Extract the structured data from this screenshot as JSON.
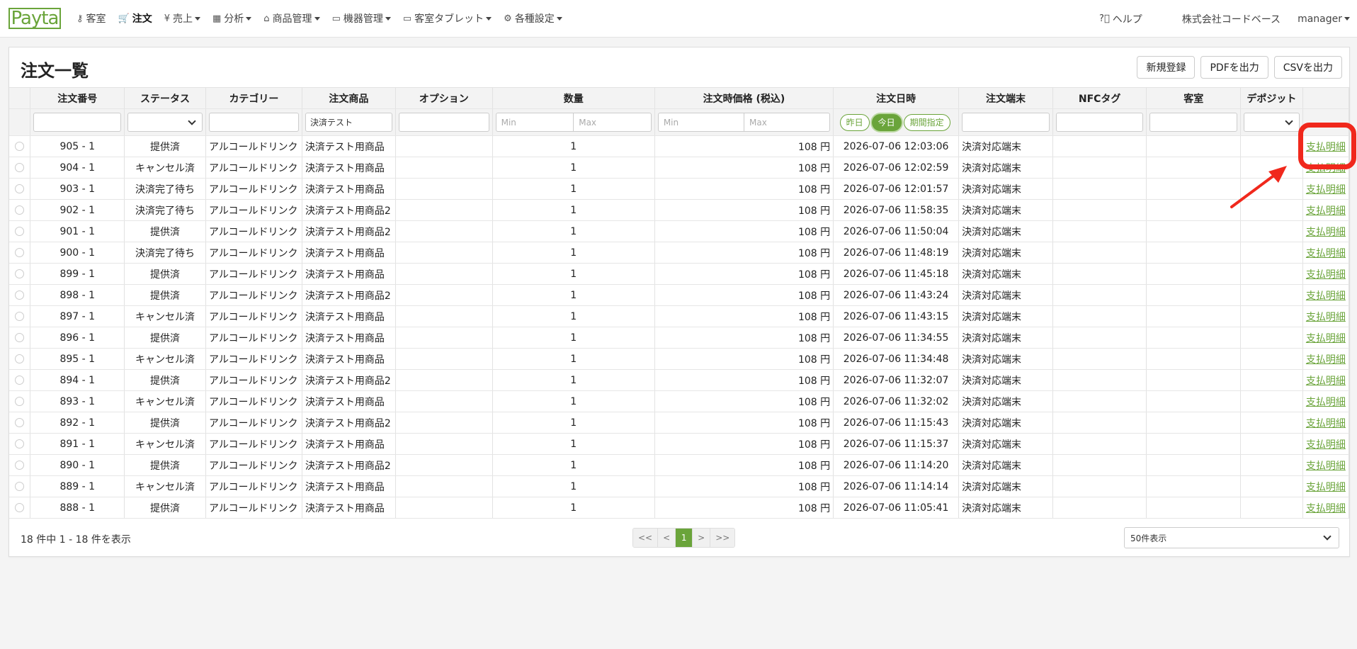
{
  "nav": {
    "logo": "Payta",
    "items": [
      {
        "label": "客室",
        "icon": "key-icon",
        "glyph": "⚷",
        "caret": false,
        "active": false
      },
      {
        "label": "注文",
        "icon": "cart-icon",
        "glyph": "🛒",
        "caret": false,
        "active": true
      },
      {
        "label": "売上",
        "icon": "yen-icon",
        "glyph": "¥",
        "caret": true,
        "active": false
      },
      {
        "label": "分析",
        "icon": "table-icon",
        "glyph": "▦",
        "caret": true,
        "active": false
      },
      {
        "label": "商品管理",
        "icon": "shop-icon",
        "glyph": "⌂",
        "caret": true,
        "active": false
      },
      {
        "label": "機器管理",
        "icon": "device-icon",
        "glyph": "▭",
        "caret": true,
        "active": false
      },
      {
        "label": "客室タブレット",
        "icon": "tablet-icon",
        "glyph": "▭",
        "caret": true,
        "active": false
      },
      {
        "label": "各種設定",
        "icon": "gear-icon",
        "glyph": "⚙",
        "caret": true,
        "active": false
      }
    ],
    "help": "ヘルプ",
    "company": "株式会社コードベース",
    "user": "manager"
  },
  "page": {
    "title": "注文一覧",
    "buttons": [
      "新規登録",
      "PDFを出力",
      "CSVを出力"
    ]
  },
  "table": {
    "headers": [
      "",
      "注文番号",
      "ステータス",
      "カテゴリー",
      "注文商品",
      "オプション",
      "数量",
      "注文時価格 (税込)",
      "注文日時",
      "注文端末",
      "NFCタグ",
      "客室",
      "デポジット",
      ""
    ],
    "filters": {
      "product_value": "決済テスト",
      "min": "Min",
      "max": "Max",
      "pill_yesterday": "昨日",
      "pill_today": "今日",
      "pill_range": "期間指定"
    },
    "rows": [
      {
        "no": "905 - 1",
        "status": "提供済",
        "cat": "アルコールドリンク",
        "item": "決済テスト用商品",
        "qty": "1",
        "price": "108 円",
        "time": "2026-07-06 12:03:06",
        "term": "決済対応端末",
        "link": "支払明細"
      },
      {
        "no": "904 - 1",
        "status": "キャンセル済",
        "cat": "アルコールドリンク",
        "item": "決済テスト用商品",
        "qty": "1",
        "price": "108 円",
        "time": "2026-07-06 12:02:59",
        "term": "決済対応端末",
        "link": "支払明細"
      },
      {
        "no": "903 - 1",
        "status": "決済完了待ち",
        "cat": "アルコールドリンク",
        "item": "決済テスト用商品",
        "qty": "1",
        "price": "108 円",
        "time": "2026-07-06 12:01:57",
        "term": "決済対応端末",
        "link": "支払明細"
      },
      {
        "no": "902 - 1",
        "status": "決済完了待ち",
        "cat": "アルコールドリンク",
        "item": "決済テスト用商品2",
        "qty": "1",
        "price": "108 円",
        "time": "2026-07-06 11:58:35",
        "term": "決済対応端末",
        "link": "支払明細"
      },
      {
        "no": "901 - 1",
        "status": "提供済",
        "cat": "アルコールドリンク",
        "item": "決済テスト用商品2",
        "qty": "1",
        "price": "108 円",
        "time": "2026-07-06 11:50:04",
        "term": "決済対応端末",
        "link": "支払明細"
      },
      {
        "no": "900 - 1",
        "status": "決済完了待ち",
        "cat": "アルコールドリンク",
        "item": "決済テスト用商品",
        "qty": "1",
        "price": "108 円",
        "time": "2026-07-06 11:48:19",
        "term": "決済対応端末",
        "link": "支払明細"
      },
      {
        "no": "899 - 1",
        "status": "提供済",
        "cat": "アルコールドリンク",
        "item": "決済テスト用商品",
        "qty": "1",
        "price": "108 円",
        "time": "2026-07-06 11:45:18",
        "term": "決済対応端末",
        "link": "支払明細"
      },
      {
        "no": "898 - 1",
        "status": "提供済",
        "cat": "アルコールドリンク",
        "item": "決済テスト用商品2",
        "qty": "1",
        "price": "108 円",
        "time": "2026-07-06 11:43:24",
        "term": "決済対応端末",
        "link": "支払明細"
      },
      {
        "no": "897 - 1",
        "status": "キャンセル済",
        "cat": "アルコールドリンク",
        "item": "決済テスト用商品",
        "qty": "1",
        "price": "108 円",
        "time": "2026-07-06 11:43:15",
        "term": "決済対応端末",
        "link": "支払明細"
      },
      {
        "no": "896 - 1",
        "status": "提供済",
        "cat": "アルコールドリンク",
        "item": "決済テスト用商品",
        "qty": "1",
        "price": "108 円",
        "time": "2026-07-06 11:34:55",
        "term": "決済対応端末",
        "link": "支払明細"
      },
      {
        "no": "895 - 1",
        "status": "キャンセル済",
        "cat": "アルコールドリンク",
        "item": "決済テスト用商品",
        "qty": "1",
        "price": "108 円",
        "time": "2026-07-06 11:34:48",
        "term": "決済対応端末",
        "link": "支払明細"
      },
      {
        "no": "894 - 1",
        "status": "提供済",
        "cat": "アルコールドリンク",
        "item": "決済テスト用商品2",
        "qty": "1",
        "price": "108 円",
        "time": "2026-07-06 11:32:07",
        "term": "決済対応端末",
        "link": "支払明細"
      },
      {
        "no": "893 - 1",
        "status": "キャンセル済",
        "cat": "アルコールドリンク",
        "item": "決済テスト用商品",
        "qty": "1",
        "price": "108 円",
        "time": "2026-07-06 11:32:02",
        "term": "決済対応端末",
        "link": "支払明細"
      },
      {
        "no": "892 - 1",
        "status": "提供済",
        "cat": "アルコールドリンク",
        "item": "決済テスト用商品2",
        "qty": "1",
        "price": "108 円",
        "time": "2026-07-06 11:15:43",
        "term": "決済対応端末",
        "link": "支払明細"
      },
      {
        "no": "891 - 1",
        "status": "キャンセル済",
        "cat": "アルコールドリンク",
        "item": "決済テスト用商品",
        "qty": "1",
        "price": "108 円",
        "time": "2026-07-06 11:15:37",
        "term": "決済対応端末",
        "link": "支払明細"
      },
      {
        "no": "890 - 1",
        "status": "提供済",
        "cat": "アルコールドリンク",
        "item": "決済テスト用商品2",
        "qty": "1",
        "price": "108 円",
        "time": "2026-07-06 11:14:20",
        "term": "決済対応端末",
        "link": "支払明細"
      },
      {
        "no": "889 - 1",
        "status": "キャンセル済",
        "cat": "アルコールドリンク",
        "item": "決済テスト用商品",
        "qty": "1",
        "price": "108 円",
        "time": "2026-07-06 11:14:14",
        "term": "決済対応端末",
        "link": "支払明細"
      },
      {
        "no": "888 - 1",
        "status": "提供済",
        "cat": "アルコールドリンク",
        "item": "決済テスト用商品",
        "qty": "1",
        "price": "108 円",
        "time": "2026-07-06 11:05:41",
        "term": "決済対応端末",
        "link": "支払明細"
      }
    ]
  },
  "footer": {
    "info": "18 件中 1 - 18 件を表示",
    "pager": [
      "<<",
      "<",
      "1",
      ">",
      ">>"
    ],
    "current_page": "1",
    "per_page": "50件表示"
  },
  "colors": {
    "accent": "#6aa43a",
    "annotation": "#f0281c"
  }
}
